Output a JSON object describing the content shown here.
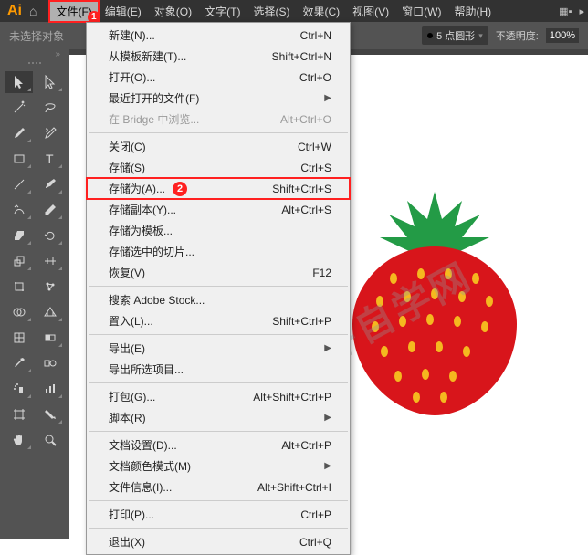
{
  "menubar": {
    "logo": "Ai",
    "items": [
      "文件(F)",
      "编辑(E)",
      "对象(O)",
      "文字(T)",
      "选择(S)",
      "效果(C)",
      "视图(V)",
      "窗口(W)",
      "帮助(H)"
    ]
  },
  "secbar": {
    "selection_status": "未选择对象",
    "stroke_value": "5 点圆形",
    "opacity_label": "不透明度:",
    "opacity_value": "100%"
  },
  "dropdown_groups": [
    [
      {
        "label": "新建(N)...",
        "shortcut": "Ctrl+N"
      },
      {
        "label": "从模板新建(T)...",
        "shortcut": "Shift+Ctrl+N"
      },
      {
        "label": "打开(O)...",
        "shortcut": "Ctrl+O"
      },
      {
        "label": "最近打开的文件(F)",
        "arrow": true
      },
      {
        "label": "在 Bridge 中浏览...",
        "shortcut": "Alt+Ctrl+O",
        "disabled": true
      }
    ],
    [
      {
        "label": "关闭(C)",
        "shortcut": "Ctrl+W"
      },
      {
        "label": "存储(S)",
        "shortcut": "Ctrl+S"
      },
      {
        "label": "存储为(A)...",
        "shortcut": "Shift+Ctrl+S",
        "highlighted": true,
        "badge": "2"
      },
      {
        "label": "存储副本(Y)...",
        "shortcut": "Alt+Ctrl+S"
      },
      {
        "label": "存储为模板..."
      },
      {
        "label": "存储选中的切片..."
      },
      {
        "label": "恢复(V)",
        "shortcut": "F12"
      }
    ],
    [
      {
        "label": "搜索 Adobe Stock..."
      },
      {
        "label": "置入(L)...",
        "shortcut": "Shift+Ctrl+P"
      }
    ],
    [
      {
        "label": "导出(E)",
        "arrow": true
      },
      {
        "label": "导出所选项目..."
      }
    ],
    [
      {
        "label": "打包(G)...",
        "shortcut": "Alt+Shift+Ctrl+P"
      },
      {
        "label": "脚本(R)",
        "arrow": true
      }
    ],
    [
      {
        "label": "文档设置(D)...",
        "shortcut": "Alt+Ctrl+P"
      },
      {
        "label": "文档颜色模式(M)",
        "arrow": true
      },
      {
        "label": "文件信息(I)...",
        "shortcut": "Alt+Shift+Ctrl+I"
      }
    ],
    [
      {
        "label": "打印(P)...",
        "shortcut": "Ctrl+P"
      }
    ],
    [
      {
        "label": "退出(X)",
        "shortcut": "Ctrl+Q"
      }
    ]
  ],
  "badge_file": "1",
  "watermark": "软件自学网",
  "colors": {
    "strawberry_body": "#d8151b",
    "strawberry_leaf": "#239b46",
    "strawberry_seed": "#f5b81f"
  }
}
